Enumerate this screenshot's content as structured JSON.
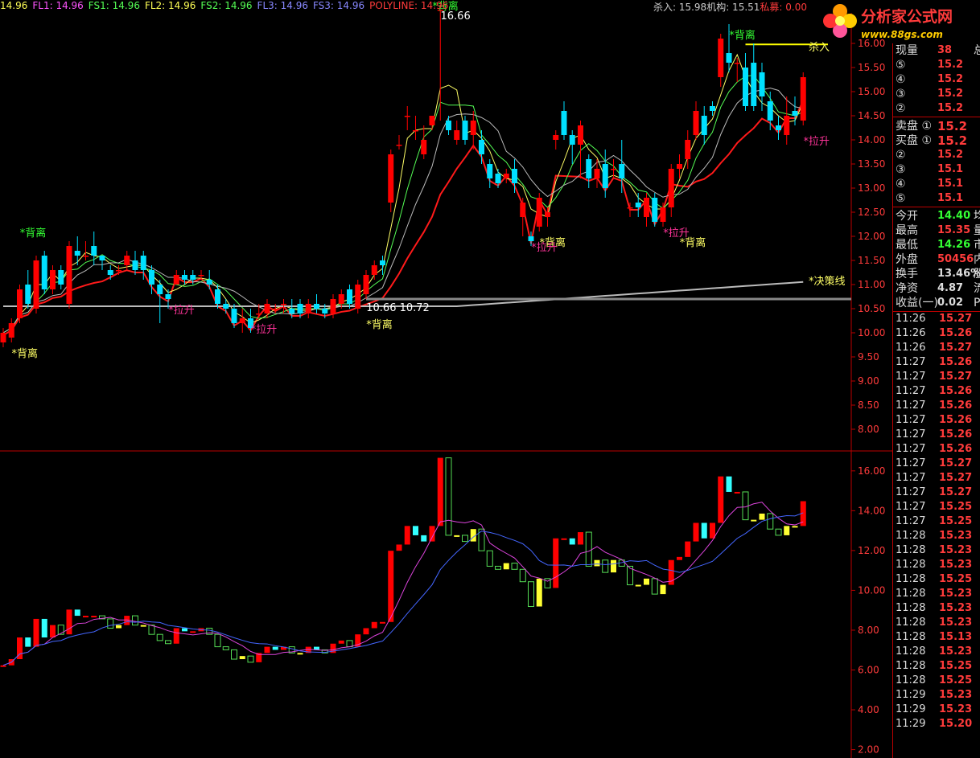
{
  "legend": [
    {
      "text": "14.96",
      "color": "#ffff55"
    },
    {
      "text": "FL1: 14.96",
      "color": "#ff55ff"
    },
    {
      "text": "FS1: 14.96",
      "color": "#55ff55"
    },
    {
      "text": "FL2: 14.96",
      "color": "#ffff55"
    },
    {
      "text": "FS2: 14.96",
      "color": "#55ff55"
    },
    {
      "text": "FL3: 14.96",
      "color": "#8888ff"
    },
    {
      "text": "FS3: 14.96",
      "color": "#8888ff"
    },
    {
      "text": "POLYLINE: 14.96",
      "color": "#ff3b3b"
    }
  ],
  "legend_right": [
    {
      "text": "杀入: 15.98",
      "color": "#cccccc"
    },
    {
      "text": "机构: 15.51",
      "color": "#cccccc"
    },
    {
      "text": "私募: 0.00",
      "color": "#ff3b3b"
    }
  ],
  "logo": {
    "title": "分析家公式网",
    "url": "www.88gs.com"
  },
  "colors": {
    "up": "#ff0000",
    "down": "#00e0ff",
    "signal_green": "#33ff33",
    "signal_yellow": "#ffff66",
    "signal_magenta": "#ff3399"
  },
  "chart_data": [
    {
      "type": "candlestick",
      "ylim": [
        7.6,
        16.6
      ],
      "yticks": [
        "16.00",
        "15.50",
        "15.00",
        "14.50",
        "14.00",
        "13.50",
        "13.00",
        "12.50",
        "12.00",
        "11.50",
        "11.00",
        "10.50",
        "10.00",
        "9.50",
        "9.00",
        "8.50",
        "8.00"
      ],
      "candles": [
        [
          9.8,
          10.0,
          9.7,
          10.1
        ],
        [
          9.9,
          10.2,
          9.8,
          10.3
        ],
        [
          10.3,
          10.9,
          10.2,
          11.0
        ],
        [
          11.0,
          10.6,
          10.5,
          11.3
        ],
        [
          10.5,
          11.5,
          10.4,
          11.6
        ],
        [
          11.6,
          10.9,
          10.8,
          11.7
        ],
        [
          10.9,
          11.3,
          10.8,
          11.4
        ],
        [
          11.3,
          11.0,
          10.9,
          11.4
        ],
        [
          10.6,
          11.8,
          10.5,
          11.9
        ],
        [
          11.7,
          11.6,
          11.4,
          12.0
        ],
        [
          11.6,
          11.6,
          11.5,
          11.9
        ],
        [
          11.8,
          11.6,
          11.4,
          12.1
        ],
        [
          11.6,
          11.5,
          11.3,
          11.6
        ],
        [
          11.3,
          11.2,
          11.1,
          11.4
        ],
        [
          11.3,
          11.3,
          11.2,
          11.4
        ],
        [
          11.4,
          11.6,
          11.3,
          11.7
        ],
        [
          11.5,
          11.3,
          11.2,
          11.7
        ],
        [
          11.6,
          11.3,
          11.1,
          11.7
        ],
        [
          11.3,
          11.0,
          10.8,
          11.4
        ],
        [
          11.0,
          10.8,
          10.2,
          11.1
        ],
        [
          10.8,
          10.7,
          10.5,
          10.9
        ],
        [
          11.0,
          11.2,
          11.0,
          11.3
        ],
        [
          11.2,
          11.1,
          11.0,
          11.3
        ],
        [
          11.2,
          11.1,
          11.0,
          11.3
        ],
        [
          11.2,
          11.2,
          11.1,
          11.3
        ],
        [
          11.1,
          11.0,
          10.9,
          11.3
        ],
        [
          10.9,
          10.6,
          10.5,
          11.0
        ],
        [
          10.6,
          10.5,
          10.4,
          10.7
        ],
        [
          10.5,
          10.2,
          10.1,
          10.6
        ],
        [
          10.2,
          10.3,
          10.0,
          10.5
        ],
        [
          10.3,
          10.1,
          10.0,
          10.5
        ],
        [
          10.4,
          10.4,
          10.3,
          10.6
        ],
        [
          10.4,
          10.6,
          10.3,
          10.7
        ],
        [
          10.5,
          10.5,
          10.4,
          10.6
        ],
        [
          10.6,
          10.6,
          10.4,
          10.7
        ],
        [
          10.5,
          10.4,
          10.3,
          10.7
        ],
        [
          10.6,
          10.4,
          10.3,
          10.7
        ],
        [
          10.4,
          10.6,
          10.3,
          10.7
        ],
        [
          10.6,
          10.5,
          10.4,
          10.8
        ],
        [
          10.5,
          10.4,
          10.3,
          10.6
        ],
        [
          10.4,
          10.7,
          10.3,
          10.8
        ],
        [
          10.6,
          10.8,
          10.5,
          10.9
        ],
        [
          10.9,
          10.6,
          10.5,
          11.0
        ],
        [
          10.5,
          11.0,
          10.4,
          11.1
        ],
        [
          10.8,
          11.2,
          10.7,
          11.3
        ],
        [
          11.2,
          11.4,
          11.1,
          11.5
        ],
        [
          11.5,
          11.4,
          11.2,
          11.6
        ],
        [
          12.7,
          13.7,
          12.5,
          13.8
        ],
        [
          13.9,
          13.9,
          13.8,
          14.1
        ],
        [
          14.5,
          14.5,
          14.2,
          14.7
        ],
        [
          14.2,
          14.2,
          14.0,
          14.5
        ],
        [
          13.7,
          14.0,
          13.6,
          14.3
        ],
        [
          14.3,
          14.5,
          14.2,
          14.4
        ],
        [
          16.7,
          16.7,
          14.4,
          16.7
        ],
        [
          14.4,
          14.2,
          14.1,
          14.5
        ],
        [
          14.0,
          14.2,
          13.9,
          14.4
        ],
        [
          14.4,
          14.0,
          13.9,
          14.5
        ],
        [
          14.1,
          14.4,
          13.8,
          14.6
        ],
        [
          14.0,
          13.7,
          13.5,
          14.2
        ],
        [
          13.5,
          13.2,
          13.0,
          13.6
        ],
        [
          13.3,
          13.1,
          13.0,
          13.4
        ],
        [
          13.2,
          13.3,
          13.1,
          13.4
        ],
        [
          13.4,
          13.1,
          12.9,
          13.6
        ],
        [
          12.4,
          12.7,
          12.0,
          12.8
        ],
        [
          12.0,
          11.9,
          11.8,
          12.1
        ],
        [
          12.2,
          12.8,
          12.1,
          12.9
        ],
        [
          12.4,
          12.5,
          12.2,
          12.6
        ],
        [
          14.0,
          14.1,
          13.8,
          14.2
        ],
        [
          14.6,
          14.1,
          14.0,
          14.8
        ],
        [
          14.1,
          13.9,
          13.5,
          14.2
        ],
        [
          13.9,
          14.3,
          13.2,
          14.4
        ],
        [
          13.6,
          13.2,
          13.0,
          13.7
        ],
        [
          13.2,
          13.4,
          13.0,
          13.6
        ],
        [
          13.5,
          13.0,
          12.8,
          13.8
        ],
        [
          13.4,
          13.4,
          13.2,
          13.6
        ],
        [
          13.5,
          13.2,
          12.9,
          14.0
        ],
        [
          12.6,
          12.6,
          12.4,
          12.7
        ],
        [
          12.7,
          12.6,
          12.4,
          12.9
        ],
        [
          12.4,
          12.8,
          12.2,
          12.9
        ],
        [
          12.8,
          12.3,
          12.2,
          12.9
        ],
        [
          12.3,
          12.6,
          12.2,
          12.7
        ],
        [
          12.6,
          13.4,
          12.4,
          13.5
        ],
        [
          13.4,
          13.5,
          13.2,
          13.7
        ],
        [
          13.6,
          14.0,
          13.4,
          14.2
        ],
        [
          14.1,
          14.6,
          14.0,
          14.8
        ],
        [
          14.5,
          14.1,
          13.9,
          14.7
        ],
        [
          14.7,
          14.6,
          14.5,
          14.8
        ],
        [
          15.3,
          16.1,
          15.1,
          16.2
        ],
        [
          15.8,
          15.6,
          15.4,
          16.4
        ],
        [
          15.6,
          15.6,
          15.2,
          15.7
        ],
        [
          15.5,
          14.7,
          14.6,
          15.8
        ],
        [
          15.6,
          14.7,
          14.6,
          16.0
        ],
        [
          15.4,
          14.9,
          14.6,
          15.6
        ],
        [
          14.8,
          14.4,
          14.2,
          15.0
        ],
        [
          14.3,
          14.2,
          14.0,
          14.5
        ],
        [
          14.1,
          14.5,
          13.9,
          14.9
        ],
        [
          14.6,
          14.5,
          14.3,
          14.9
        ],
        [
          14.4,
          15.3,
          14.3,
          15.4
        ]
      ],
      "annotations": [
        {
          "text": "*背离",
          "color": "#33ff33",
          "price": 12.0,
          "bar": 3
        },
        {
          "text": "*背离",
          "color": "#33ff33",
          "price": 16.7,
          "bar": 53
        },
        {
          "text": "16.66",
          "color": "#ffffff",
          "price": 16.5,
          "bar": 54
        },
        {
          "text": "*背离",
          "color": "#ffff66",
          "price": 9.5,
          "bar": 2
        },
        {
          "text": "*拉升",
          "color": "#ff3399",
          "price": 10.4,
          "bar": 21
        },
        {
          "text": "*拉升",
          "color": "#ff3399",
          "price": 10.0,
          "bar": 31
        },
        {
          "text": "*背离",
          "color": "#ffff66",
          "price": 10.1,
          "bar": 45
        },
        {
          "text": "*背离",
          "color": "#ffff66",
          "price": 11.8,
          "bar": 66
        },
        {
          "text": "*拉升",
          "color": "#ff3399",
          "price": 11.7,
          "bar": 65
        },
        {
          "text": "*拉升",
          "color": "#ff3399",
          "price": 12.0,
          "bar": 81
        },
        {
          "text": "*背离",
          "color": "#ffff66",
          "price": 11.8,
          "bar": 83
        },
        {
          "text": "*背离",
          "color": "#33ff33",
          "price": 16.1,
          "bar": 89
        },
        {
          "text": "*拉升",
          "color": "#ff3399",
          "price": 13.9,
          "bar": 98
        },
        {
          "text": "杀入",
          "color": "#ffff66",
          "price": 15.85,
          "bar": 100
        },
        {
          "text": "*决策线",
          "color": "#ffff66",
          "price": 11.0,
          "bar": 100
        },
        {
          "text": "10.66 10.72",
          "color": "#ffffff",
          "price": 10.45,
          "bar": 45
        }
      ]
    },
    {
      "type": "bar",
      "ylim": [
        1.7,
        16.8
      ],
      "yticks": [
        "16.00",
        "14.00",
        "12.00",
        "10.00",
        "8.00",
        "6.00",
        "4.00",
        "2.00"
      ]
    }
  ],
  "panel": {
    "rows": [
      {
        "label": "现量",
        "value": "38",
        "color": "#ff3b3b",
        "cut": "总"
      },
      {
        "label": "⑤",
        "value": "15.2",
        "color": "#ff3b3b",
        "cut": ""
      },
      {
        "label": "④",
        "value": "15.2",
        "color": "#ff3b3b",
        "cut": ""
      },
      {
        "label": "③",
        "value": "15.2",
        "color": "#ff3b3b",
        "cut": ""
      },
      {
        "label": "②",
        "value": "15.2",
        "color": "#ff3b3b",
        "cut": ""
      },
      {
        "label": "卖盘 ①",
        "value": "15.2",
        "color": "#ff3b3b",
        "cut": ""
      },
      {
        "label": "买盘 ①",
        "value": "15.2",
        "color": "#ff3b3b",
        "cut": ""
      },
      {
        "label": "②",
        "value": "15.2",
        "color": "#ff3b3b",
        "cut": ""
      },
      {
        "label": "③",
        "value": "15.1",
        "color": "#ff3b3b",
        "cut": ""
      },
      {
        "label": "④",
        "value": "15.1",
        "color": "#ff3b3b",
        "cut": ""
      },
      {
        "label": "⑤",
        "value": "15.1",
        "color": "#ff3b3b",
        "cut": ""
      },
      {
        "label": "今开",
        "value": "14.40",
        "color": "#33ff33",
        "cut": "均"
      },
      {
        "label": "最高",
        "value": "15.35",
        "color": "#ff3b3b",
        "cut": "量"
      },
      {
        "label": "最低",
        "value": "14.26",
        "color": "#33ff33",
        "cut": "市"
      },
      {
        "label": "外盘",
        "value": "50456",
        "color": "#ff3b3b",
        "cut": "内"
      },
      {
        "label": "换手",
        "value": "13.46%",
        "color": "#dddddd",
        "cut": "股"
      },
      {
        "label": "净资",
        "value": "4.87",
        "color": "#dddddd",
        "cut": "流"
      },
      {
        "label": "收益(一)",
        "value": "0.02",
        "color": "#dddddd",
        "cut": "P"
      }
    ],
    "ticks": [
      [
        "11:26",
        "15.27"
      ],
      [
        "11:26",
        "15.26"
      ],
      [
        "11:26",
        "15.27"
      ],
      [
        "11:27",
        "15.26"
      ],
      [
        "11:27",
        "15.27"
      ],
      [
        "11:27",
        "15.26"
      ],
      [
        "11:27",
        "15.26"
      ],
      [
        "11:27",
        "15.26"
      ],
      [
        "11:27",
        "15.26"
      ],
      [
        "11:27",
        "15.26"
      ],
      [
        "11:27",
        "15.27"
      ],
      [
        "11:27",
        "15.27"
      ],
      [
        "11:27",
        "15.27"
      ],
      [
        "11:27",
        "15.25"
      ],
      [
        "11:27",
        "15.25"
      ],
      [
        "11:28",
        "15.23"
      ],
      [
        "11:28",
        "15.23"
      ],
      [
        "11:28",
        "15.23"
      ],
      [
        "11:28",
        "15.25"
      ],
      [
        "11:28",
        "15.23"
      ],
      [
        "11:28",
        "15.23"
      ],
      [
        "11:28",
        "15.23"
      ],
      [
        "11:28",
        "15.13"
      ],
      [
        "11:28",
        "15.23"
      ],
      [
        "11:28",
        "15.25"
      ],
      [
        "11:28",
        "15.25"
      ],
      [
        "11:29",
        "15.23"
      ],
      [
        "11:29",
        "15.23"
      ],
      [
        "11:29",
        "15.20"
      ]
    ]
  }
}
